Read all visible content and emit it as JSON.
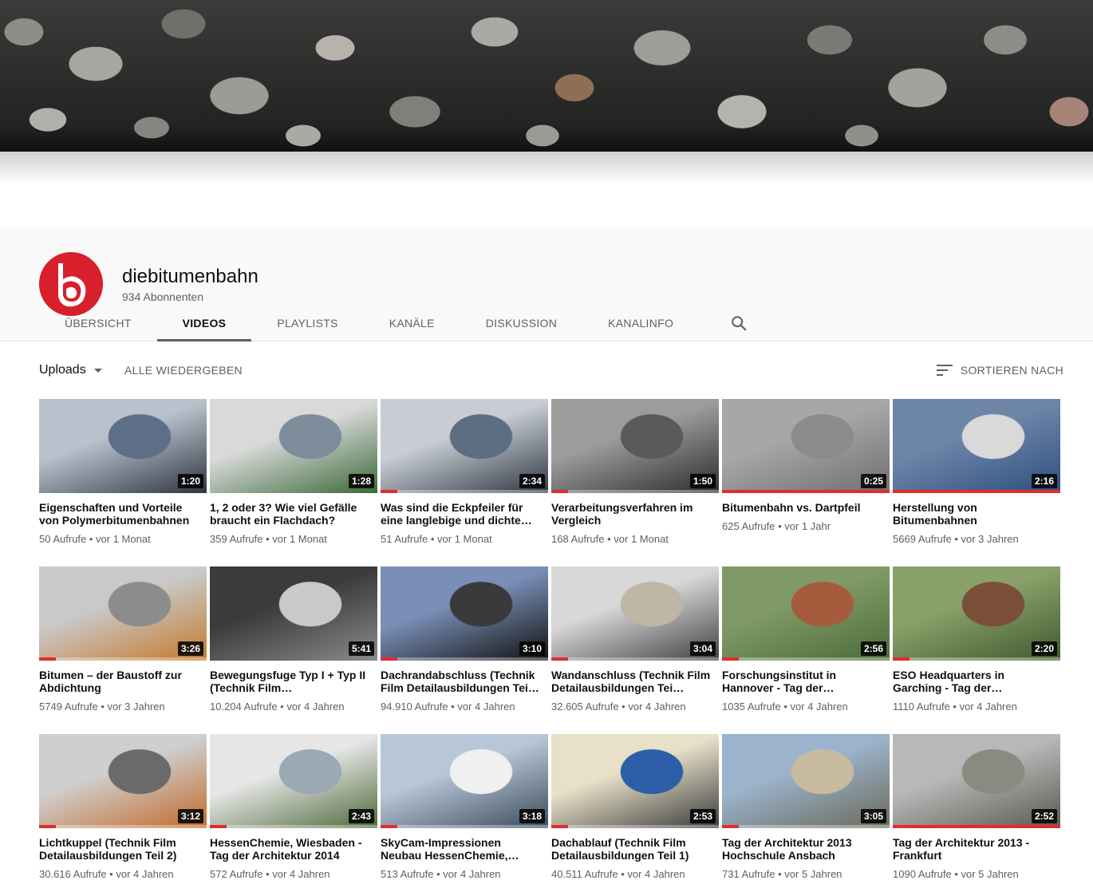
{
  "channel": {
    "name": "diebitumenbahn",
    "subscribers": "934 Abonnenten",
    "brand_color": "#d8202d"
  },
  "tabs": [
    {
      "label": "ÜBERSICHT",
      "active": false
    },
    {
      "label": "VIDEOS",
      "active": true
    },
    {
      "label": "PLAYLISTS",
      "active": false
    },
    {
      "label": "KANÄLE",
      "active": false
    },
    {
      "label": "DISKUSSION",
      "active": false
    },
    {
      "label": "KANALINFO",
      "active": false
    }
  ],
  "search_icon": "search-icon",
  "toolbar": {
    "uploads_label": "Uploads",
    "play_all_label": "ALLE WIEDERGEBEN",
    "sort_label": "SORTIEREN NACH"
  },
  "videos": [
    {
      "title": "Eigenschaften und Vorteile von Polymerbitumenbahnen",
      "duration": "1:20",
      "meta": "50 Aufrufe • vor 1 Monat",
      "progress": 0,
      "thumb": [
        "#b9c2cc",
        "#5d6f86",
        "#2e3542"
      ]
    },
    {
      "title": "1, 2 oder 3? Wie viel Gefälle braucht ein Flachdach?",
      "duration": "1:28",
      "meta": "359 Aufrufe • vor 1 Monat",
      "progress": 0,
      "thumb": [
        "#d9d9d9",
        "#7d8d9c",
        "#3b6a3a"
      ]
    },
    {
      "title": "Was sind die Eckpfeiler für eine langlebige und dichte…",
      "duration": "2:34",
      "meta": "51 Aufrufe • vor 1 Monat",
      "progress": 0.1,
      "thumb": [
        "#c7cdd3",
        "#5e6e82",
        "#303743"
      ]
    },
    {
      "title": "Verarbeitungsverfahren im Vergleich",
      "duration": "1:50",
      "meta": "168 Aufrufe • vor 1 Monat",
      "progress": 0.1,
      "thumb": [
        "#9c9c9c",
        "#5a5a5a",
        "#2c2c2c"
      ]
    },
    {
      "title": "Bitumenbahn vs. Dartpfeil",
      "duration": "0:25",
      "meta": "625 Aufrufe • vor 1 Jahr",
      "progress": 1.0,
      "thumb": [
        "#a7a7a7",
        "#8b8b8b",
        "#6f6f6f"
      ]
    },
    {
      "title": "Herstellung von Bitumenbahnen",
      "duration": "2:16",
      "meta": "5669 Aufrufe • vor 3 Jahren",
      "progress": 1.0,
      "thumb": [
        "#6d86a8",
        "#d9d9d9",
        "#2f4f7f"
      ]
    },
    {
      "title": "Bitumen – der Baustoff zur Abdichtung",
      "duration": "3:26",
      "meta": "5749 Aufrufe • vor 3 Jahren",
      "progress": 0.1,
      "thumb": [
        "#c9c9c9",
        "#8c8c8c",
        "#c47a2c"
      ]
    },
    {
      "title": "Bewegungsfuge Typ I + Typ II (Technik Film…",
      "duration": "5:41",
      "meta": "10.204 Aufrufe • vor 4 Jahren",
      "progress": 0,
      "thumb": [
        "#3b3b3b",
        "#c9c9c9",
        "#8a8a8a"
      ]
    },
    {
      "title": "Dachrandabschluss (Technik Film Detailausbildungen Tei…",
      "duration": "3:10",
      "meta": "94.910 Aufrufe • vor 4 Jahren",
      "progress": 0.1,
      "thumb": [
        "#7a8fb8",
        "#3a3a3a",
        "#111111"
      ]
    },
    {
      "title": "Wandanschluss (Technik Film Detailausbildungen Tei…",
      "duration": "3:04",
      "meta": "32.605 Aufrufe • vor 4 Jahren",
      "progress": 0.1,
      "thumb": [
        "#d8d8d8",
        "#bfb7a6",
        "#404040"
      ]
    },
    {
      "title": "Forschungsinstitut in Hannover - Tag der…",
      "duration": "2:56",
      "meta": "1035 Aufrufe • vor 4 Jahren",
      "progress": 0.1,
      "thumb": [
        "#7f9a66",
        "#a65b3c",
        "#4c6b3a"
      ]
    },
    {
      "title": "ESO Headquarters in Garching - Tag der…",
      "duration": "2:20",
      "meta": "1110 Aufrufe • vor 4 Jahren",
      "progress": 0.1,
      "thumb": [
        "#8aa06a",
        "#7a4f3a",
        "#3f5a2e"
      ]
    },
    {
      "title": "Lichtkuppel (Technik Film Detailausbildungen Teil 2)",
      "duration": "3:12",
      "meta": "30.616 Aufrufe • vor 4 Jahren",
      "progress": 0.1,
      "thumb": [
        "#cfcfcf",
        "#6a6a6a",
        "#c26a2a"
      ]
    },
    {
      "title": "HessenChemie, Wiesbaden - Tag der Architektur 2014",
      "duration": "2:43",
      "meta": "572 Aufrufe • vor 4 Jahren",
      "progress": 0.1,
      "thumb": [
        "#e6e6e6",
        "#9aa9b4",
        "#4f6a3a"
      ]
    },
    {
      "title": "SkyCam-Impressionen Neubau HessenChemie,…",
      "duration": "3:18",
      "meta": "513 Aufrufe • vor 4 Jahren",
      "progress": 0.1,
      "thumb": [
        "#b8c7d8",
        "#f0f0f0",
        "#3c4b5a"
      ]
    },
    {
      "title": "Dachablauf (Technik Film Detailausbildungen Teil 1)",
      "duration": "2:53",
      "meta": "40.511 Aufrufe • vor 4 Jahren",
      "progress": 0.1,
      "thumb": [
        "#e8e0c8",
        "#2d5fa8",
        "#3a3a3a"
      ]
    },
    {
      "title": "Tag der Architektur 2013 Hochschule Ansbach",
      "duration": "3:05",
      "meta": "731 Aufrufe • vor 5 Jahren",
      "progress": 0.1,
      "thumb": [
        "#9bb3cc",
        "#c9bba0",
        "#6a6a5a"
      ]
    },
    {
      "title": "Tag der Architektur 2013 - Frankfurt",
      "duration": "2:52",
      "meta": "1090 Aufrufe • vor 5 Jahren",
      "progress": 1.0,
      "thumb": [
        "#b8b8b8",
        "#8a8a80",
        "#5a5a52"
      ]
    }
  ]
}
